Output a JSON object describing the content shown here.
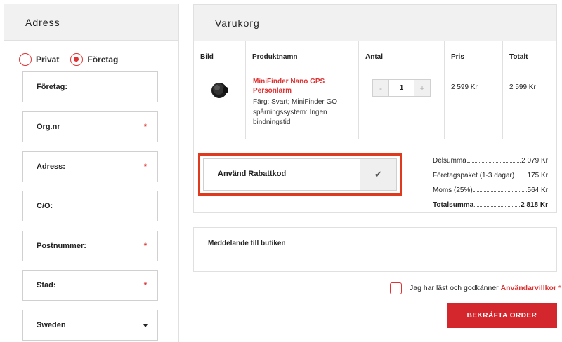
{
  "address": {
    "title": "Adress",
    "customer_type": {
      "options": [
        "Privat",
        "Företag"
      ],
      "selected": "Företag"
    },
    "fields": [
      {
        "label": "Företag:",
        "required": false
      },
      {
        "label": "Org.nr",
        "required": true
      },
      {
        "label": "Adress:",
        "required": true
      },
      {
        "label": "C/O:",
        "required": false
      },
      {
        "label": "Postnummer:",
        "required": true
      },
      {
        "label": "Stad:",
        "required": true
      }
    ],
    "required_marker": "*",
    "country": "Sweden"
  },
  "cart": {
    "title": "Varukorg",
    "columns": [
      "Bild",
      "Produktnamn",
      "Antal",
      "Pris",
      "Totalt"
    ],
    "item": {
      "name": "MiniFinder Nano GPS Personlarm",
      "description": "Färg: Svart; MiniFinder GO spårningssystem: Ingen bindningstid",
      "quantity": "1",
      "price": "2 599 Kr",
      "total": "2 599 Kr",
      "minus": "-",
      "plus": "+"
    },
    "coupon_label": "Använd Rabattkod",
    "summary": [
      {
        "label": "Delsumma",
        "value": "2 079 Kr"
      },
      {
        "label": "Företagspaket (1-3 dagar)",
        "value": "175 Kr"
      },
      {
        "label": "Moms (25%)",
        "value": "564 Kr"
      },
      {
        "label": "Totalsumma",
        "value": "2 818 Kr"
      }
    ]
  },
  "message": {
    "label": "Meddelande till butiken"
  },
  "terms": {
    "text": "Jag har läst och godkänner ",
    "link": "Användarvillkor",
    "required": " *"
  },
  "confirm_button": "BEKRÄFTA ORDER",
  "colors": {
    "accent": "#d3272d",
    "highlight": "#e03a1e",
    "header_bg": "#f1f1f1"
  }
}
